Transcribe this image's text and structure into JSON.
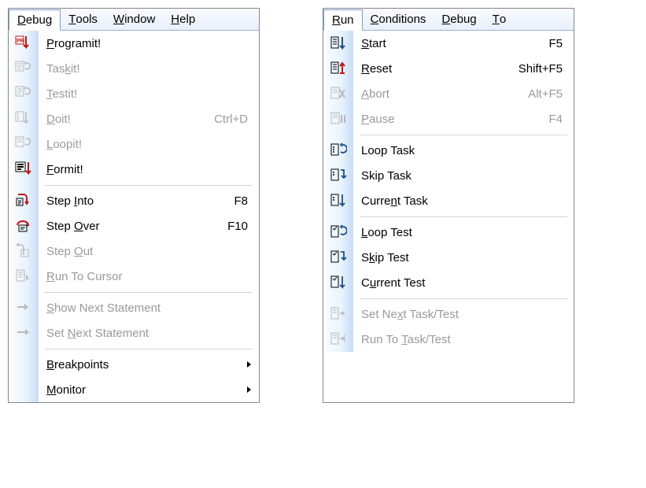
{
  "left": {
    "menubar": [
      "Debug",
      "Tools",
      "Window",
      "Help"
    ],
    "openIndex": 0,
    "items": [
      {
        "label": "Programit!",
        "shortcut": "",
        "enabled": true,
        "icon": "pr-down",
        "ul": 0
      },
      {
        "label": "Taskit!",
        "shortcut": "",
        "enabled": false,
        "icon": "task-cycle",
        "ul": 3
      },
      {
        "label": "Testit!",
        "shortcut": "",
        "enabled": false,
        "icon": "test-cycle",
        "ul": 0
      },
      {
        "label": "Doit!",
        "shortcut": "Ctrl+D",
        "enabled": false,
        "icon": "do-down",
        "ul": 0
      },
      {
        "label": "Loopit!",
        "shortcut": "",
        "enabled": false,
        "icon": "loop-cycle",
        "ul": 0
      },
      {
        "label": "Formit!",
        "shortcut": "",
        "enabled": true,
        "icon": "form-down",
        "ul": 0
      },
      {
        "sep": true
      },
      {
        "label": "Step Into",
        "shortcut": "F8",
        "enabled": true,
        "icon": "step-into",
        "ul": 5
      },
      {
        "label": "Step Over",
        "shortcut": "F10",
        "enabled": true,
        "icon": "step-over",
        "ul": 5
      },
      {
        "label": "Step Out",
        "shortcut": "",
        "enabled": false,
        "icon": "step-out",
        "ul": 5
      },
      {
        "label": "Run To Cursor",
        "shortcut": "",
        "enabled": false,
        "icon": "run-to-cursor",
        "ul": 0
      },
      {
        "sep": true
      },
      {
        "label": "Show Next Statement",
        "shortcut": "",
        "enabled": false,
        "icon": "show-next",
        "ul": 0
      },
      {
        "label": "Set Next Statement",
        "shortcut": "",
        "enabled": false,
        "icon": "set-next",
        "ul": 4
      },
      {
        "sep": true
      },
      {
        "label": "Breakpoints",
        "shortcut": "",
        "enabled": true,
        "icon": "",
        "submenu": true,
        "ul": 0
      },
      {
        "label": "Monitor",
        "shortcut": "",
        "enabled": true,
        "icon": "",
        "submenu": true,
        "ul": 0
      }
    ]
  },
  "right": {
    "menubar": [
      "Run",
      "Conditions",
      "Debug",
      "To"
    ],
    "openIndex": 0,
    "items": [
      {
        "label": "Start",
        "shortcut": "F5",
        "enabled": true,
        "icon": "list-down",
        "ul": 0
      },
      {
        "label": "Reset",
        "shortcut": "Shift+F5",
        "enabled": true,
        "icon": "list-reset",
        "ul": 0
      },
      {
        "label": "Abort",
        "shortcut": "Alt+F5",
        "enabled": false,
        "icon": "abort",
        "ul": 0
      },
      {
        "label": "Pause",
        "shortcut": "F4",
        "enabled": false,
        "icon": "pause",
        "ul": 0
      },
      {
        "sep": true
      },
      {
        "label": "Loop Task",
        "shortcut": "",
        "enabled": true,
        "icon": "loop-task",
        "ul": -1
      },
      {
        "label": "Skip Task",
        "shortcut": "",
        "enabled": true,
        "icon": "skip-task",
        "ul": -1
      },
      {
        "label": "Current Task",
        "shortcut": "",
        "enabled": true,
        "icon": "current-task",
        "ul": 5
      },
      {
        "sep": true
      },
      {
        "label": "Loop Test",
        "shortcut": "",
        "enabled": true,
        "icon": "loop-test",
        "ul": 0
      },
      {
        "label": "Skip Test",
        "shortcut": "",
        "enabled": true,
        "icon": "skip-test",
        "ul": 1
      },
      {
        "label": "Current Test",
        "shortcut": "",
        "enabled": true,
        "icon": "current-test",
        "ul": 1
      },
      {
        "sep": true
      },
      {
        "label": "Set Next Task/Test",
        "shortcut": "",
        "enabled": false,
        "icon": "set-next-task",
        "ul": 6
      },
      {
        "label": "Run To Task/Test",
        "shortcut": "",
        "enabled": false,
        "icon": "run-to-task",
        "ul": 7
      }
    ]
  }
}
